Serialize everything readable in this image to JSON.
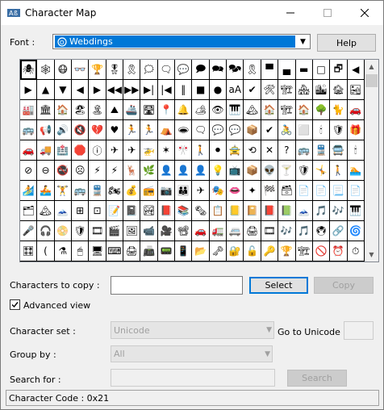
{
  "window": {
    "title": "Character Map"
  },
  "font": {
    "label": "Font :",
    "selected": "Webdings",
    "help_label": "Help"
  },
  "grid": {
    "cells": [
      "🕷",
      "🕸",
      "😷",
      "👓",
      "🏆",
      "🎖",
      "🎗",
      "🗯",
      "🗨",
      "💬",
      "🗩",
      "🗪",
      "🗫",
      "🎗",
      "▀",
      "▄",
      "▬",
      "□",
      "🗗",
      "◀",
      "▶",
      "▲",
      "▼",
      "◀",
      "▶",
      "◀◀",
      "▶▶",
      "▶|",
      "|◀",
      "‖",
      "■",
      "●",
      "aA",
      "✔",
      "🛠",
      "🏗",
      "🏘",
      "🏙",
      "🏚",
      "🏜",
      "🏭",
      "🏛",
      "🏠",
      "🏖",
      "🏝",
      "⛰",
      "🚢",
      "🛣",
      "📍",
      "🔔",
      "🏕",
      "👁",
      "🎹",
      "🏔",
      "🏠",
      "🏗",
      "🏠",
      "🌳",
      "🐈",
      "🚗",
      "🚌",
      "📢",
      "🔊",
      "🔇",
      "💔",
      "♥",
      "🏃",
      "🏃",
      "⛺",
      "🕳",
      "🗨",
      "💬",
      "💬",
      "📦",
      "✔",
      "🚴",
      "⬜",
      "🕯",
      "🛡",
      "🎁",
      "🚗",
      "🚚",
      "🏥",
      "🛑",
      "ⓘ",
      "✈",
      "✈",
      "🚁",
      "✶",
      "🎌",
      "🚶",
      "⚫",
      "🚖",
      "⟲",
      "✕",
      "?",
      "🚌",
      "🚆",
      "🚍",
      "🕯",
      "⊘",
      "⊖",
      "🚭",
      "☹",
      "⚡",
      "⚡",
      "🦌",
      "🌿",
      "👤",
      "👤",
      "👤",
      "💡",
      "📺",
      "📦",
      "👽",
      "🍸",
      "🛡",
      "🤸",
      "🚶",
      "🏊",
      "🏄",
      "🚣",
      "🏋",
      "🚌",
      "🚆",
      "🏍",
      "💰",
      "📻",
      "📷",
      "👪",
      "✈",
      "🎭",
      "👄",
      "✦",
      "🏁",
      "🗃",
      "📄",
      "📄",
      "📃",
      "📄",
      "🗂",
      "🏔",
      "🗻",
      "⊞",
      "⊡",
      "📝",
      "📓",
      "🏞",
      "📕",
      "📚",
      "🗞",
      "📋",
      "📒",
      "📔",
      "📕",
      "📗",
      "🗻",
      "🎵",
      "🎶",
      "🎹",
      "🎤",
      "🎧",
      "📀",
      "🛡",
      "🎞",
      "🎬",
      "🖼",
      "📹",
      "🎥",
      "📽",
      "🚗",
      "🚛",
      "🚐",
      "🖨",
      "🎞",
      "🎶",
      "🎵",
      "🖲",
      "🔗",
      "🌀",
      "🎛",
      "(",
      "⚗",
      "🖱",
      "🖥",
      "⌨",
      "🖨",
      "📠",
      "📟",
      "📱",
      "📂",
      "🗝",
      "🔐",
      "🔓",
      "🔑",
      "🏆",
      "🏗",
      "🚫",
      "⏰",
      "⏱",
      "🌧",
      "🌦",
      "🌩",
      "🌨",
      "🌬",
      "☁",
      "🌪",
      "🌫",
      "🌊",
      "🌡",
      "🛏",
      "🛋",
      "🍽",
      "🗺",
      "🧭",
      "🌐",
      "🏚",
      "🛥",
      "Ⓟ"
    ],
    "selected_index": 0
  },
  "copy": {
    "label": "Characters to copy :",
    "value": "",
    "select_label": "Select",
    "copy_label": "Copy"
  },
  "advanced": {
    "label": "Advanced view",
    "checked": true
  },
  "charset": {
    "label": "Character set :",
    "value": "Unicode",
    "goto_label": "Go to Unicode :",
    "goto_value": ""
  },
  "groupby": {
    "label": "Group by :",
    "value": "All"
  },
  "search": {
    "label": "Search for :",
    "value": "",
    "button_label": "Search"
  },
  "status": {
    "text": "Character Code : 0x21"
  },
  "colors": {
    "accent": "#0078d7",
    "window_bg": "#f0f0f0"
  }
}
